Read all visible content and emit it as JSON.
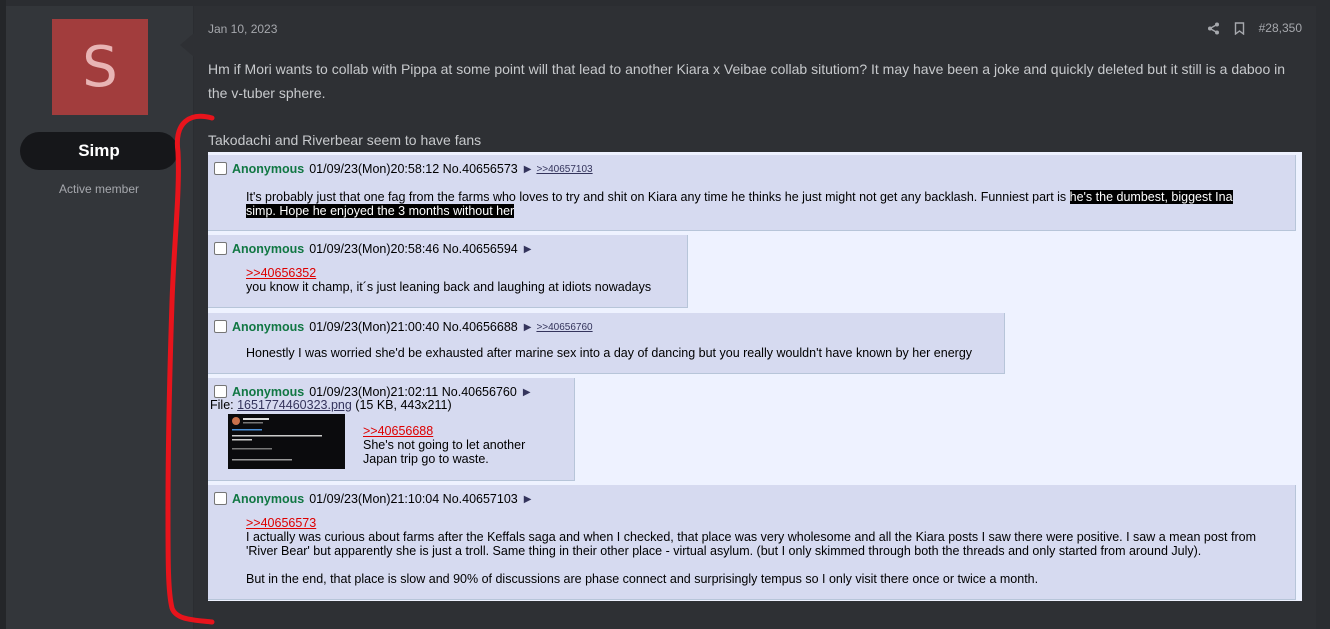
{
  "user": {
    "avatar_letter": "S",
    "name": "Simp",
    "title": "Active member"
  },
  "post": {
    "date": "Jan 10, 2023",
    "number": "#28,350",
    "text1": "Hm if Mori wants to collab with Pippa at some point will that lead to another Kiara x Veibae collab situtiom? It may have been a joke and quickly deleted but it still is a daboo in the v-tuber sphere.",
    "text2": "Takodachi and Riverbear seem to have fans"
  },
  "embed": {
    "replies": [
      {
        "name": "Anonymous",
        "meta": "01/09/23(Mon)20:58:12 No.40656573",
        "arrow": "▶",
        "backlink": ">>40657103",
        "body_plain": "It's probably just that one fag from the farms who loves to try and shit on Kiara any time he thinks he just might not get any backlash. Funniest part is ",
        "body_spoiler1": "he's the dumbest, biggest Ina",
        "body_spoiler2": "simp. Hope he enjoyed the 3 months without her"
      },
      {
        "name": "Anonymous",
        "meta": "01/09/23(Mon)20:58:46 No.40656594",
        "arrow": "▶",
        "quote": ">>40656352",
        "body": "you know it champ, it´s just leaning back and laughing at idiots nowadays"
      },
      {
        "name": "Anonymous",
        "meta": "01/09/23(Mon)21:00:40 No.40656688",
        "arrow": "▶",
        "backlink": ">>40656760",
        "body": "Honestly I was worried she'd be exhausted after marine sex into a day of dancing but you really wouldn't have known by her energy"
      },
      {
        "name": "Anonymous",
        "meta": "01/09/23(Mon)21:02:11 No.40656760",
        "arrow": "▶",
        "file_label": "File: ",
        "file_name": "1651774460323.png",
        "file_info": " (15 KB, 443x211)",
        "quote": ">>40656688",
        "body_line1": "She's not going to let another",
        "body_line2": "Japan trip go to waste."
      },
      {
        "name": "Anonymous",
        "meta": "01/09/23(Mon)21:10:04 No.40657103",
        "arrow": "▶",
        "quote": ">>40656573",
        "body_p1": "I actually was curious about farms after the Keffals saga and when I checked, that place was very wholesome and all the Kiara posts I saw there were positive. I saw a mean post from 'River Bear' but apparently she is just a troll. Same thing in their other place - virtual asylum. (but I only skimmed through both the threads and only started from around July).",
        "body_p2": "But in the end, that place is slow and 90% of discussions are phase connect and surprisingly tempus so I only visit there once or twice a month."
      }
    ]
  },
  "colors": {
    "annotation_line": "#e8141c",
    "name_green": "#117743",
    "quote_red": "#dd0000"
  }
}
